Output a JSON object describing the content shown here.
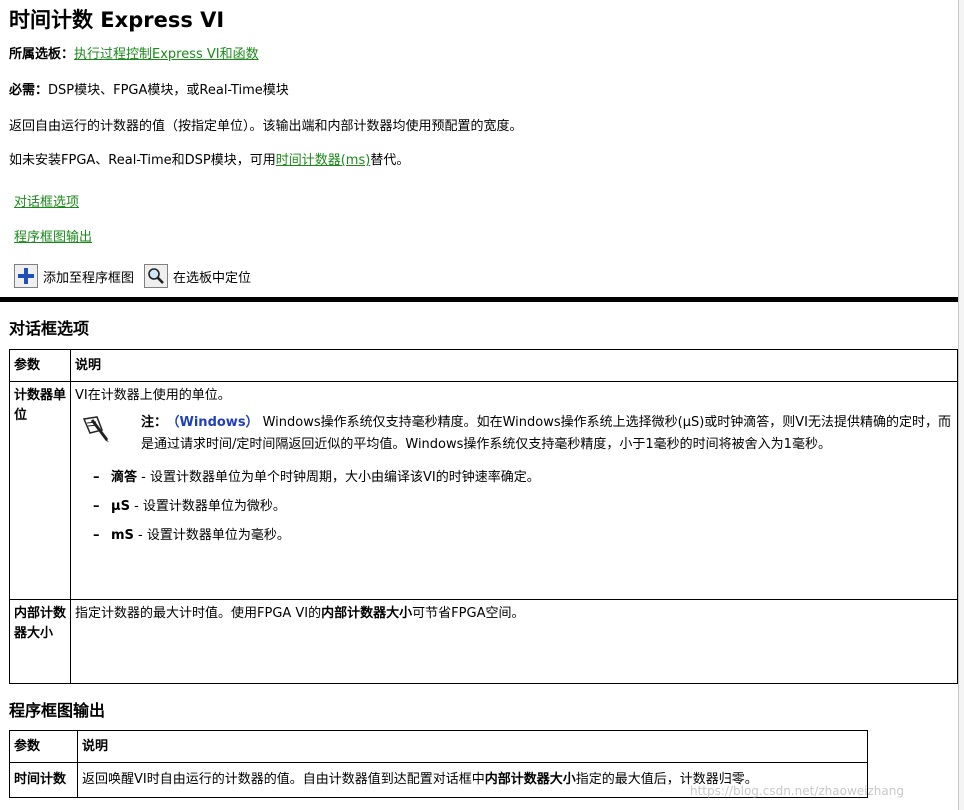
{
  "header": {
    "title": "时间计数 Express VI",
    "palette_label": "所属选板：",
    "palette_link": "执行过程控制Express VI和函数",
    "requires_label": "必需：",
    "requires_text": "DSP模块、FPGA模块，或Real-Time模块",
    "description": "返回自由运行的计数器的值（按指定单位）。该输出端和内部计数器均使用预配置的宽度。",
    "alt_prefix": "如未安装FPGA、Real-Time和DSP模块，可用",
    "alt_link": "时间计数器(ms)",
    "alt_suffix": "替代。",
    "nav_dialog_link": "对话框选项",
    "nav_diagram_link": "程序框图输出",
    "add_to_diagram_label": "添加至程序框图",
    "find_on_palette_label": "在选板中定位"
  },
  "dialog_section": {
    "title": "对话框选项",
    "col_param": "参数",
    "col_desc": "说明",
    "rows": [
      {
        "param": "计数器单位",
        "desc": "VI在计数器上使用的单位。",
        "note_label": "注：",
        "note_platform": "（Windows）",
        "note_text": "Windows操作系统仅支持毫秒精度。如在Windows操作系统上选择微秒(μS)或时钟滴答，则VI无法提供精确的定时，而是通过请求时间/定时间隔返回近似的平均值。Windows操作系统仅支持毫秒精度，小于1毫秒的时间将被舍入为1毫秒。",
        "options": [
          {
            "dash": "–",
            "term": "滴答",
            "text": " - 设置计数器单位为单个时钟周期，大小由编译该VI的时钟速率确定。"
          },
          {
            "dash": "–",
            "term": "μS",
            "text": " - 设置计数器单位为微秒。"
          },
          {
            "dash": "–",
            "term": "mS",
            "text": " - 设置计数器单位为毫秒。"
          }
        ]
      },
      {
        "param": "内部计数器大小",
        "desc_prefix": "指定计数器的最大计时值。使用FPGA VI的",
        "desc_bold": "内部计数器大小",
        "desc_suffix": "可节省FPGA空间。"
      }
    ]
  },
  "diagram_section": {
    "title": "程序框图输出",
    "col_param": "参数",
    "col_desc": "说明",
    "rows": [
      {
        "param": "时间计数",
        "desc_prefix": "返回唤醒VI时自由运行的计数器的值。自由计数器值到达配置对话框中",
        "desc_bold": "内部计数器大小",
        "desc_suffix": "指定的最大值后，计数器归零。"
      }
    ]
  },
  "watermark": "https://blog.csdn.net/zhaoweizhang"
}
